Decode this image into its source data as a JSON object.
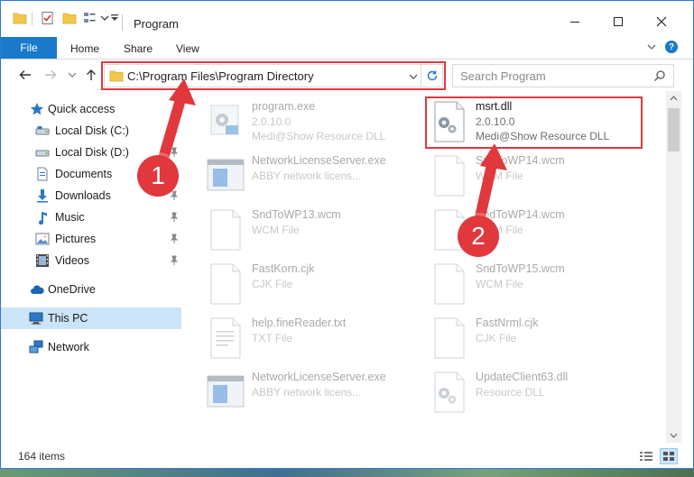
{
  "window": {
    "title": "Program"
  },
  "ribbon": {
    "file": "File",
    "home": "Home",
    "share": "Share",
    "view": "View"
  },
  "address": {
    "path": "C:\\Program Files\\Program Directory"
  },
  "search": {
    "placeholder": "Search Program"
  },
  "sidebar": {
    "items": [
      {
        "label": "Quick access"
      },
      {
        "label": "Local Disk (C:)"
      },
      {
        "label": "Local Disk (D:)"
      },
      {
        "label": "Documents"
      },
      {
        "label": "Downloads"
      },
      {
        "label": "Music"
      },
      {
        "label": "Pictures"
      },
      {
        "label": "Videos"
      },
      {
        "label": "OneDrive"
      },
      {
        "label": "This PC"
      },
      {
        "label": "Network"
      }
    ]
  },
  "files": [
    {
      "name": "program.exe",
      "line2": "2.0.10.0",
      "line3": "Medi@Show Resource DLL"
    },
    {
      "name": "msrt.dll",
      "line2": "2.0.10.0",
      "line3": "Medi@Show Resource DLL"
    },
    {
      "name": "NetworkLicenseServer.exe",
      "line2": "ABBY network licens...",
      "line3": ""
    },
    {
      "name": "SndToWP14.wcm",
      "line2": "WCM File",
      "line3": ""
    },
    {
      "name": "SndToWP13.wcm",
      "line2": "WCM File",
      "line3": ""
    },
    {
      "name": "SndToWP14.wcm",
      "line2": "WCM File",
      "line3": ""
    },
    {
      "name": "FastKorn.cjk",
      "line2": "CJK File",
      "line3": ""
    },
    {
      "name": "SndToWP15.wcm",
      "line2": "WCM File",
      "line3": ""
    },
    {
      "name": "help.fineReader.txt",
      "line2": "TXT File",
      "line3": ""
    },
    {
      "name": "FastNrml.cjk",
      "line2": "CJK File",
      "line3": ""
    },
    {
      "name": "NetworkLicenseServer.exe",
      "line2": "ABBY network licens...",
      "line3": ""
    },
    {
      "name": "UpdateClient63.dll",
      "line2": "Resource DLL",
      "line3": ""
    }
  ],
  "status": {
    "count": "164 items"
  },
  "callouts": {
    "one": "1",
    "two": "2"
  },
  "colors": {
    "accent": "#1979ca",
    "highlight": "#e0383d",
    "selected": "#cce4f7"
  }
}
